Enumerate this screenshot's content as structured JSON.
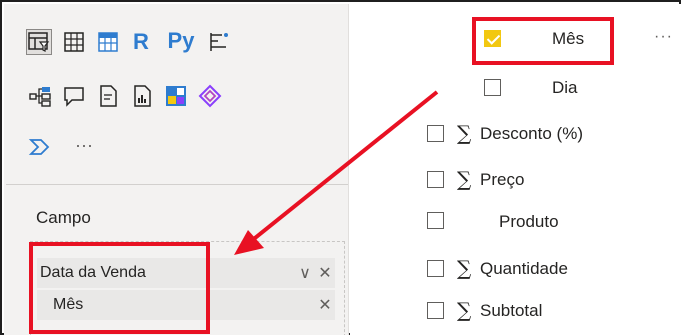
{
  "visuals": {
    "icons": [
      {
        "name": "table-visual-icon"
      },
      {
        "name": "matrix-visual-icon"
      },
      {
        "name": "table-blue-visual-icon"
      },
      {
        "name": "r-script-visual-icon",
        "text": "R"
      },
      {
        "name": "python-visual-icon",
        "text": "Py"
      },
      {
        "name": "key-influencers-icon"
      },
      {
        "name": "decomposition-tree-icon"
      },
      {
        "name": "qa-visual-icon"
      },
      {
        "name": "smart-narrative-icon"
      },
      {
        "name": "paginated-report-icon"
      },
      {
        "name": "power-apps-icon"
      },
      {
        "name": "power-automate-icon"
      },
      {
        "name": "more-visuals-icon",
        "text": "···"
      }
    ]
  },
  "fields_well": {
    "title": "Campo",
    "items": [
      {
        "label": "Data da Venda",
        "has_chevron": true,
        "remove": "✕",
        "chevron": "∨"
      },
      {
        "label": "Mês",
        "remove": "✕"
      }
    ]
  },
  "fields_list": {
    "more_label": "···",
    "items": [
      {
        "label": "Mês",
        "checked": true,
        "sigma": false
      },
      {
        "label": "Dia",
        "checked": false,
        "sigma": false
      },
      {
        "label": "Desconto (%)",
        "checked": false,
        "sigma": true
      },
      {
        "label": "Preço",
        "checked": false,
        "sigma": true
      },
      {
        "label": "Produto",
        "checked": false,
        "sigma": false
      },
      {
        "label": "Quantidade",
        "checked": false,
        "sigma": true
      },
      {
        "label": "Subtotal",
        "checked": false,
        "sigma": true
      }
    ]
  },
  "sigma_symbol": "∑",
  "colors": {
    "highlight": "#e81123",
    "check": "#f2c811",
    "accent": "#2e7ccf"
  }
}
